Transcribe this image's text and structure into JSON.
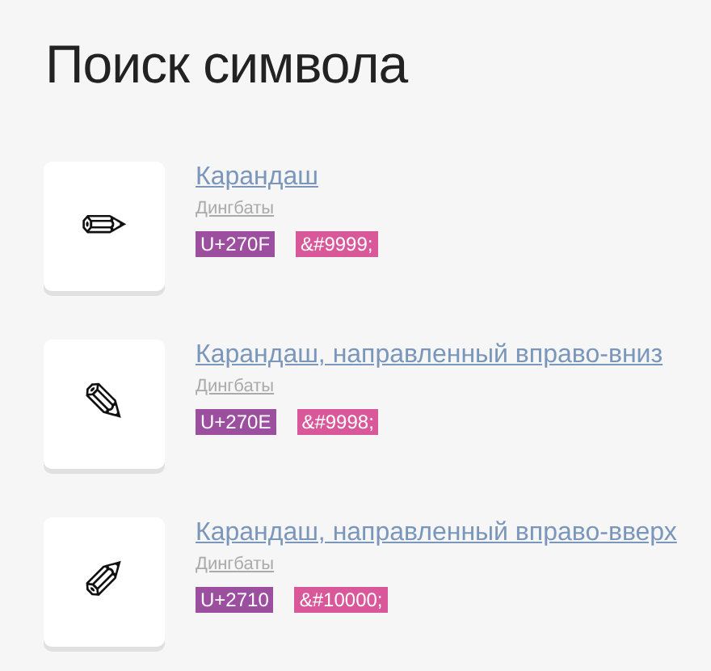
{
  "title": "Поиск символа",
  "results": [
    {
      "glyph": "✏",
      "name": "Карандаш",
      "category": "Дингбаты",
      "code": "U+270F",
      "entity": "&#9999;"
    },
    {
      "glyph": "✎",
      "name": "Карандаш, направленный вправо-вниз",
      "category": "Дингбаты",
      "code": "U+270E",
      "entity": "&#9998;"
    },
    {
      "glyph": "✐",
      "name": "Карандаш, направленный вправо-вверх",
      "category": "Дингбаты",
      "code": "U+2710",
      "entity": "&#10000;"
    }
  ]
}
